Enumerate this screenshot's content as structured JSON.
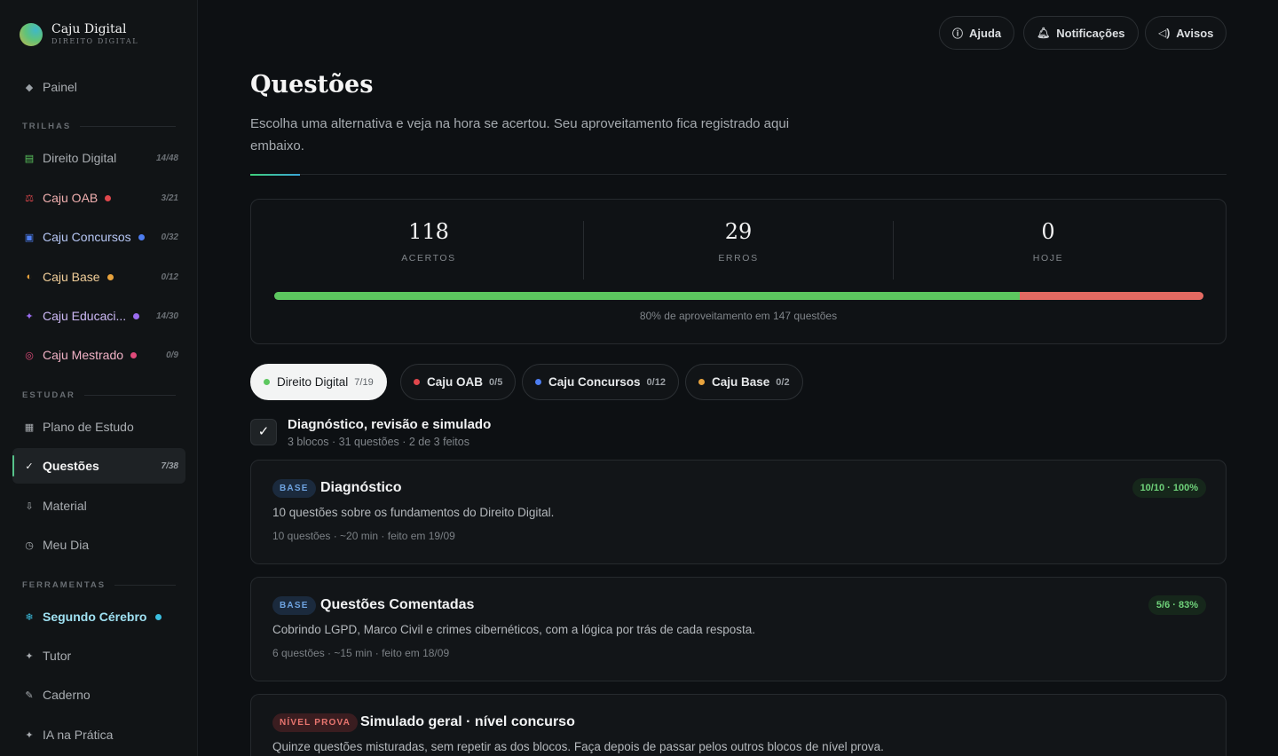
{
  "brand": {
    "title": "Caju Digital",
    "subtitle": "DIREITO DIGITAL"
  },
  "sidebar": {
    "painel": {
      "label": "Painel",
      "icon": "diamond-icon"
    },
    "sections": {
      "trilhas": "TRILHAS",
      "estudar": "ESTUDAR",
      "ferramentas": "FERRAMENTAS"
    },
    "trilhas": [
      {
        "label": "Direito Digital",
        "count": "14/48",
        "color": "#5cc75f",
        "icon": "book-icon"
      },
      {
        "label": "Caju OAB",
        "count": "3/21",
        "color": "#e0474c",
        "icon": "scale-icon"
      },
      {
        "label": "Caju Concursos",
        "count": "0/32",
        "color": "#4d7df0",
        "icon": "building-icon"
      },
      {
        "label": "Caju Base",
        "count": "0/12",
        "color": "#e8a33d",
        "icon": "half-circle-icon"
      },
      {
        "label": "Caju Educaci...",
        "count": "14/30",
        "color": "#9b6cf0",
        "icon": "sparkle-icon"
      },
      {
        "label": "Caju Mestrado",
        "count": "0/9",
        "color": "#e04a7a",
        "icon": "target-icon"
      }
    ],
    "estudar": [
      {
        "label": "Plano de Estudo",
        "count": "",
        "icon": "grid-icon"
      },
      {
        "label": "Questões",
        "count": "7/38",
        "icon": "check-icon"
      },
      {
        "label": "Material",
        "count": "",
        "icon": "download-icon"
      },
      {
        "label": "Meu Dia",
        "count": "",
        "icon": "clock-icon"
      }
    ],
    "ferramentas": [
      {
        "label": "Segundo Cérebro",
        "color": "#3bbfe0",
        "icon": "snowflake-icon"
      },
      {
        "label": "Tutor",
        "icon": "star-icon"
      },
      {
        "label": "Caderno",
        "icon": "pencil-icon"
      },
      {
        "label": "IA na Prática",
        "icon": "star-icon"
      }
    ]
  },
  "topbar": {
    "help": "Ajuda",
    "notifications": "Notificações",
    "notices": "Avisos"
  },
  "page": {
    "title": "Questões",
    "description": "Escolha uma alternativa e veja na hora se acertou. Seu aproveitamento fica registrado aqui embaixo."
  },
  "stats": {
    "acertos": {
      "value": "118",
      "label": "ACERTOS"
    },
    "erros": {
      "value": "29",
      "label": "ERROS"
    },
    "hoje": {
      "value": "0",
      "label": "HOJE"
    },
    "success_fraction": 0.8027,
    "note": "80% de aproveitamento em 147 questões",
    "colors": {
      "ok": "#5cc75f",
      "bad": "#e46a62"
    }
  },
  "tabs": [
    {
      "label": "Direito Digital",
      "count": "7/19",
      "color": "#5cc75f"
    },
    {
      "label": "Caju OAB",
      "count": "0/5",
      "color": "#e0474c"
    },
    {
      "label": "Caju Concursos",
      "count": "0/12",
      "color": "#4d7df0"
    },
    {
      "label": "Caju Base",
      "count": "0/2",
      "color": "#e8a33d"
    }
  ],
  "group": {
    "title": "Diagnóstico, revisão e simulado",
    "subtitle": "3 blocos · 31 questões · 2 de 3 feitos"
  },
  "blocks": [
    {
      "badge": "BASE",
      "title": "Diagnóstico",
      "description": "10 questões sobre os fundamentos do Direito Digital.",
      "meta": "10 questões · ~20 min · feito em 19/09",
      "score": "10/10 · 100%"
    },
    {
      "badge": "BASE",
      "title": "Questões Comentadas",
      "description": "Cobrindo LGPD, Marco Civil e crimes cibernéticos, com a lógica por trás de cada resposta.",
      "meta": "6 questões · ~15 min · feito em 18/09",
      "score": "5/6 · 83%"
    },
    {
      "badge": "NÍVEL PROVA",
      "title": "Simulado geral · nível concurso",
      "description": "Quinze questões misturadas, sem repetir as dos blocos. Faça depois de passar pelos outros blocos de nível prova."
    }
  ]
}
